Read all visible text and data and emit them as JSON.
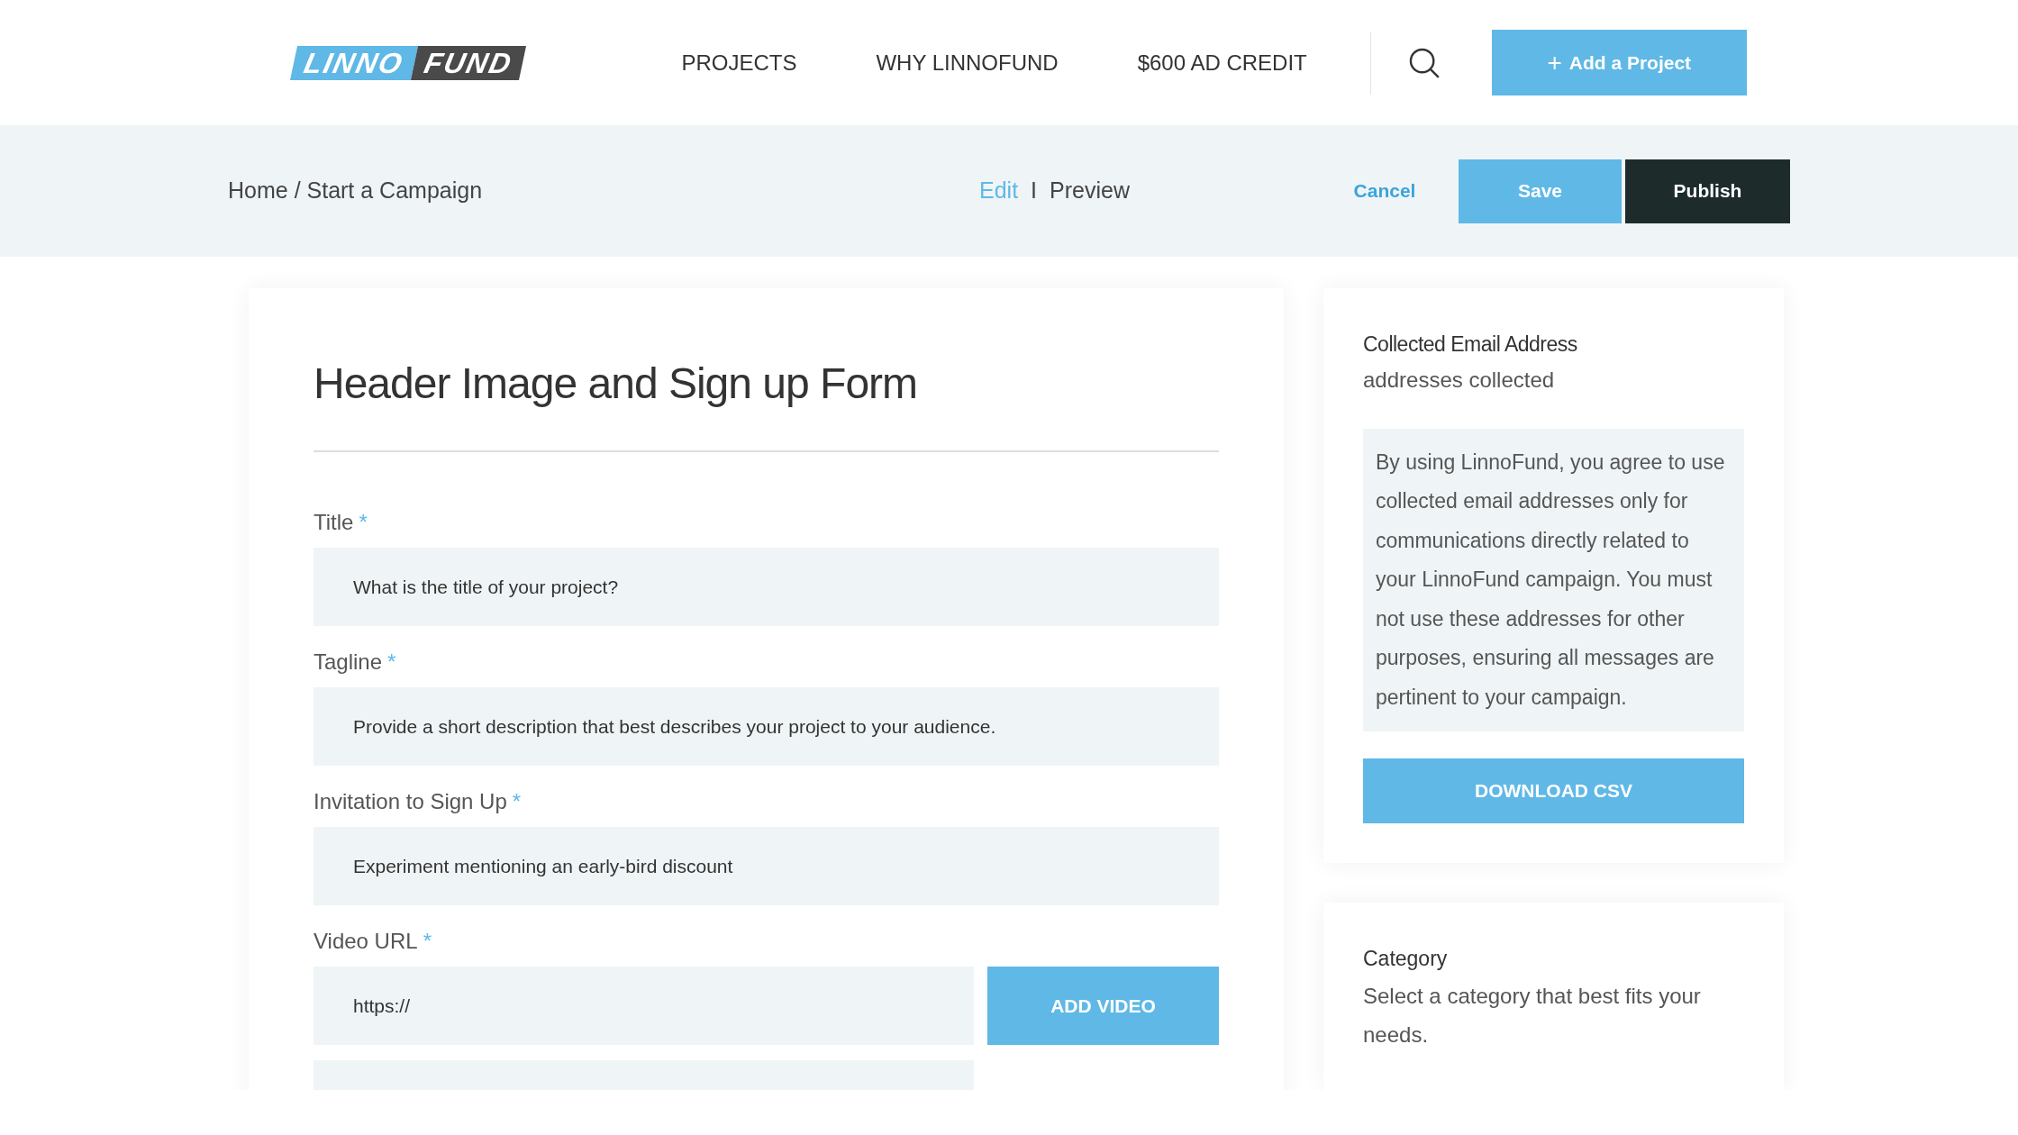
{
  "header": {
    "logo": {
      "part_1": "LINNO",
      "part_2": "FUND"
    },
    "nav": [
      {
        "label": "PROJECTS"
      },
      {
        "label": "WHY LINNOFUND"
      },
      {
        "label": "$600 AD CREDIT"
      }
    ],
    "add_button": {
      "icon": "+",
      "label": "Add a Project"
    }
  },
  "toolbar": {
    "breadcrumb": "Home / Start a Campaign",
    "modes": [
      {
        "label": "Edit",
        "selected": true
      },
      {
        "label": "Preview",
        "selected": false
      }
    ],
    "mode_separator": "I",
    "buttons": [
      {
        "label": "Cancel",
        "kind": "link"
      },
      {
        "label": "Save",
        "kind": "primary"
      },
      {
        "label": "Publish",
        "kind": "dark"
      }
    ]
  },
  "form": {
    "heading": "Header Image and Sign up Form",
    "fields": [
      {
        "label": "Title",
        "required_mark": "*",
        "placeholder": "What is the title of your project?",
        "kind": "text"
      },
      {
        "label": "Tagline",
        "required_mark": "*",
        "placeholder": "Provide a short description that best describes your project to your audience.",
        "kind": "text"
      },
      {
        "label": "Invitation to Sign Up",
        "required_mark": "*",
        "placeholder": "Experiment mentioning an early-bird discount",
        "kind": "text"
      },
      {
        "label": "Video URL",
        "required_mark": "*",
        "placeholder": "https://",
        "kind": "button",
        "button": "ADD VIDEO"
      }
    ]
  },
  "email_card": {
    "title": "Collected Email Address",
    "subtitle": "addresses collected",
    "notice": "By using LinnoFund, you agree to use collected email addresses only for communications directly related to your LinnoFund campaign. You must not use these addresses for other purposes, ensuring all messages are pertinent to your campaign.",
    "button": "DOWNLOAD CSV"
  },
  "category_card": {
    "title": "Category",
    "description": "Select a category that best fits your needs."
  }
}
